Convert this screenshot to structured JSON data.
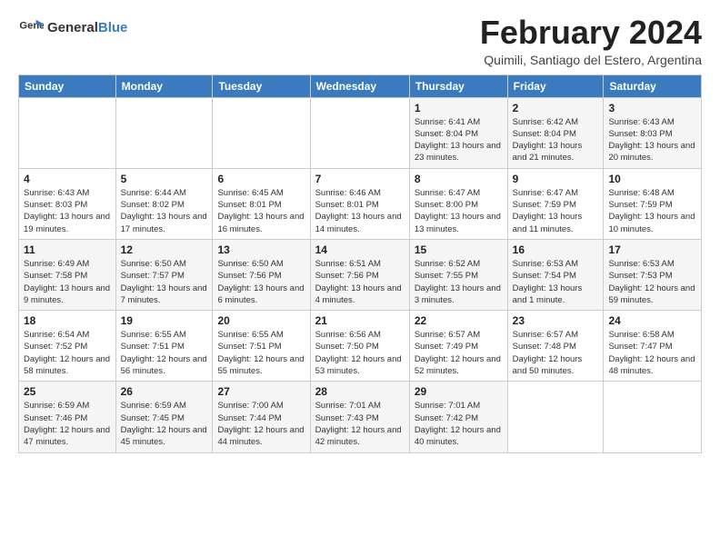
{
  "header": {
    "logo_general": "General",
    "logo_blue": "Blue",
    "month_title": "February 2024",
    "subtitle": "Quimili, Santiago del Estero, Argentina"
  },
  "weekdays": [
    "Sunday",
    "Monday",
    "Tuesday",
    "Wednesday",
    "Thursday",
    "Friday",
    "Saturday"
  ],
  "weeks": [
    [
      {
        "day": "",
        "info": ""
      },
      {
        "day": "",
        "info": ""
      },
      {
        "day": "",
        "info": ""
      },
      {
        "day": "",
        "info": ""
      },
      {
        "day": "1",
        "info": "Sunrise: 6:41 AM\nSunset: 8:04 PM\nDaylight: 13 hours and 23 minutes."
      },
      {
        "day": "2",
        "info": "Sunrise: 6:42 AM\nSunset: 8:04 PM\nDaylight: 13 hours and 21 minutes."
      },
      {
        "day": "3",
        "info": "Sunrise: 6:43 AM\nSunset: 8:03 PM\nDaylight: 13 hours and 20 minutes."
      }
    ],
    [
      {
        "day": "4",
        "info": "Sunrise: 6:43 AM\nSunset: 8:03 PM\nDaylight: 13 hours and 19 minutes."
      },
      {
        "day": "5",
        "info": "Sunrise: 6:44 AM\nSunset: 8:02 PM\nDaylight: 13 hours and 17 minutes."
      },
      {
        "day": "6",
        "info": "Sunrise: 6:45 AM\nSunset: 8:01 PM\nDaylight: 13 hours and 16 minutes."
      },
      {
        "day": "7",
        "info": "Sunrise: 6:46 AM\nSunset: 8:01 PM\nDaylight: 13 hours and 14 minutes."
      },
      {
        "day": "8",
        "info": "Sunrise: 6:47 AM\nSunset: 8:00 PM\nDaylight: 13 hours and 13 minutes."
      },
      {
        "day": "9",
        "info": "Sunrise: 6:47 AM\nSunset: 7:59 PM\nDaylight: 13 hours and 11 minutes."
      },
      {
        "day": "10",
        "info": "Sunrise: 6:48 AM\nSunset: 7:59 PM\nDaylight: 13 hours and 10 minutes."
      }
    ],
    [
      {
        "day": "11",
        "info": "Sunrise: 6:49 AM\nSunset: 7:58 PM\nDaylight: 13 hours and 9 minutes."
      },
      {
        "day": "12",
        "info": "Sunrise: 6:50 AM\nSunset: 7:57 PM\nDaylight: 13 hours and 7 minutes."
      },
      {
        "day": "13",
        "info": "Sunrise: 6:50 AM\nSunset: 7:56 PM\nDaylight: 13 hours and 6 minutes."
      },
      {
        "day": "14",
        "info": "Sunrise: 6:51 AM\nSunset: 7:56 PM\nDaylight: 13 hours and 4 minutes."
      },
      {
        "day": "15",
        "info": "Sunrise: 6:52 AM\nSunset: 7:55 PM\nDaylight: 13 hours and 3 minutes."
      },
      {
        "day": "16",
        "info": "Sunrise: 6:53 AM\nSunset: 7:54 PM\nDaylight: 13 hours and 1 minute."
      },
      {
        "day": "17",
        "info": "Sunrise: 6:53 AM\nSunset: 7:53 PM\nDaylight: 12 hours and 59 minutes."
      }
    ],
    [
      {
        "day": "18",
        "info": "Sunrise: 6:54 AM\nSunset: 7:52 PM\nDaylight: 12 hours and 58 minutes."
      },
      {
        "day": "19",
        "info": "Sunrise: 6:55 AM\nSunset: 7:51 PM\nDaylight: 12 hours and 56 minutes."
      },
      {
        "day": "20",
        "info": "Sunrise: 6:55 AM\nSunset: 7:51 PM\nDaylight: 12 hours and 55 minutes."
      },
      {
        "day": "21",
        "info": "Sunrise: 6:56 AM\nSunset: 7:50 PM\nDaylight: 12 hours and 53 minutes."
      },
      {
        "day": "22",
        "info": "Sunrise: 6:57 AM\nSunset: 7:49 PM\nDaylight: 12 hours and 52 minutes."
      },
      {
        "day": "23",
        "info": "Sunrise: 6:57 AM\nSunset: 7:48 PM\nDaylight: 12 hours and 50 minutes."
      },
      {
        "day": "24",
        "info": "Sunrise: 6:58 AM\nSunset: 7:47 PM\nDaylight: 12 hours and 48 minutes."
      }
    ],
    [
      {
        "day": "25",
        "info": "Sunrise: 6:59 AM\nSunset: 7:46 PM\nDaylight: 12 hours and 47 minutes."
      },
      {
        "day": "26",
        "info": "Sunrise: 6:59 AM\nSunset: 7:45 PM\nDaylight: 12 hours and 45 minutes."
      },
      {
        "day": "27",
        "info": "Sunrise: 7:00 AM\nSunset: 7:44 PM\nDaylight: 12 hours and 44 minutes."
      },
      {
        "day": "28",
        "info": "Sunrise: 7:01 AM\nSunset: 7:43 PM\nDaylight: 12 hours and 42 minutes."
      },
      {
        "day": "29",
        "info": "Sunrise: 7:01 AM\nSunset: 7:42 PM\nDaylight: 12 hours and 40 minutes."
      },
      {
        "day": "",
        "info": ""
      },
      {
        "day": "",
        "info": ""
      }
    ]
  ]
}
